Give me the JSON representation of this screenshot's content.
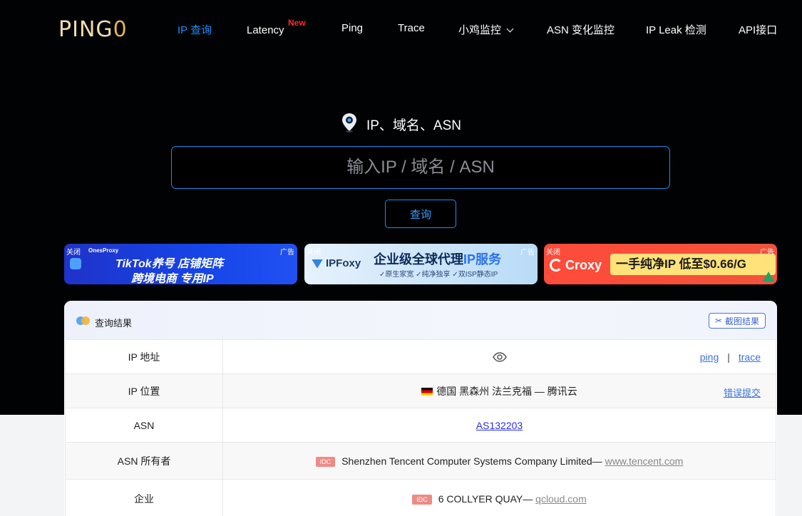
{
  "brand": {
    "logo_part1": "PING",
    "logo_part2": "0"
  },
  "nav": {
    "items": [
      {
        "label": "IP 查询"
      },
      {
        "label": "Latency",
        "badge": "New"
      },
      {
        "label": "Ping"
      },
      {
        "label": "Trace"
      },
      {
        "label": "小鸡监控"
      },
      {
        "label": "ASN 变化监控"
      },
      {
        "label": "IP Leak 检测"
      },
      {
        "label": "API接口"
      }
    ]
  },
  "search": {
    "heading": "IP、域名、ASN",
    "placeholder": "输入IP / 域名 / ASN",
    "button_label": "查询"
  },
  "ads": [
    {
      "close_label": "关闭",
      "ad_label": "广告",
      "brand": "OnesProxy",
      "line1": "TikTok养号 店铺矩阵",
      "line2": "跨境电商 专用IP"
    },
    {
      "close_label": "关闭",
      "ad_label": "广告",
      "brand": "IPFoxy",
      "headline_a": "企业级全球代理",
      "headline_b": "IP服务",
      "sub": "✓原生家宽 ✓纯净独享 ✓双ISP静态IP"
    },
    {
      "close_label": "关闭",
      "ad_label": "广告",
      "brand": "Croxy",
      "slogan": "一手纯净IP 低至$0.66/G"
    }
  ],
  "result": {
    "title": "查询结果",
    "screenshot_label": "截图结果",
    "rows": {
      "ip_address": {
        "key": "IP 地址",
        "ping_link": "ping",
        "separator": "|",
        "trace_link": "trace"
      },
      "ip_location": {
        "key": "IP 位置",
        "value": "德国 黑森州 法兰克福 — 腾讯云",
        "report_link": "错误提交"
      },
      "asn": {
        "key": "ASN",
        "value": "AS132203"
      },
      "asn_owner": {
        "key": "ASN 所有者",
        "tag": "IDC",
        "value": "Shenzhen Tencent Computer Systems Company Limited— ",
        "link": "www.tencent.com"
      },
      "company": {
        "key": "企业",
        "tag": "IDC",
        "value": "6 COLLYER QUAY— ",
        "link": "qcloud.com"
      }
    }
  },
  "colors": {
    "accent": "#1e90ff",
    "hero_bg": "#010204",
    "logo_gold": "#e3b25f",
    "new_badge": "#ff2b2b",
    "link": "#3b73d8",
    "idc_tag": "#f08a84"
  }
}
